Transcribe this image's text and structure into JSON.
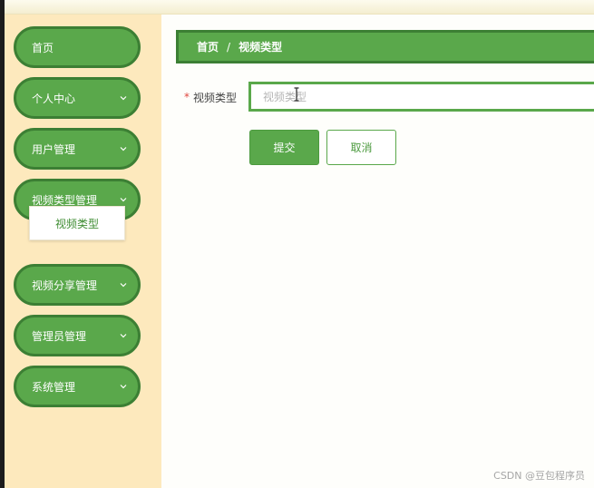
{
  "sidebar": {
    "items": [
      {
        "label": "首页",
        "has_chevron": false
      },
      {
        "label": "个人中心",
        "has_chevron": true
      },
      {
        "label": "用户管理",
        "has_chevron": true
      },
      {
        "label": "视频类型管理",
        "has_chevron": true,
        "expanded": true
      },
      {
        "label": "视频分享管理",
        "has_chevron": true
      },
      {
        "label": "管理员管理",
        "has_chevron": true
      },
      {
        "label": "系统管理",
        "has_chevron": true
      }
    ],
    "submenu": {
      "label": "视频类型"
    }
  },
  "breadcrumb": {
    "home": "首页",
    "separator": "/",
    "current": "视频类型"
  },
  "form": {
    "required_mark": "*",
    "label": "视频类型",
    "placeholder": "视频类型",
    "value": ""
  },
  "buttons": {
    "submit": "提交",
    "cancel": "取消"
  },
  "watermark": "CSDN @豆包程序员",
  "colors": {
    "accent": "#5aa84b",
    "accent_border": "#3c7f34",
    "sidebar_bg": "#fde9bd",
    "required": "#e0473f"
  },
  "icons": {
    "chevron": "chevron-down-icon",
    "cursor": "text-cursor-icon"
  }
}
